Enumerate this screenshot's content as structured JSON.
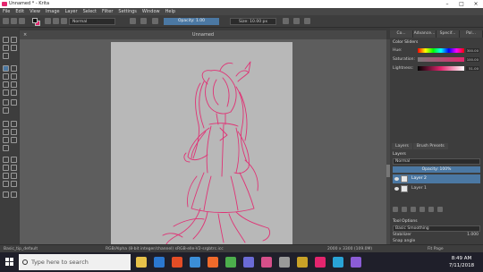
{
  "window": {
    "title": "Unnamed * - Krita",
    "controls": [
      "–",
      "□",
      "×"
    ]
  },
  "menu": [
    "File",
    "Edit",
    "View",
    "Image",
    "Layer",
    "Select",
    "Filter",
    "Settings",
    "Window",
    "Help"
  ],
  "toolbar": {
    "blend_mode": "Normal",
    "opacity": "Opacity: 1.00",
    "size": "Size: 10.00 px"
  },
  "canvas": {
    "tab_label": "Unnamed",
    "close": "×",
    "paper_color": "#b8b8b8",
    "stroke_color": "#e4256e"
  },
  "docker": {
    "tabs": [
      "Co...",
      "Advance...",
      "Specif...",
      "Pal..."
    ],
    "color_sliders_title": "Color Sliders",
    "sliders": [
      {
        "label": "Hue:",
        "value": "300.00"
      },
      {
        "label": "Saturation:",
        "value": "100.00"
      },
      {
        "label": "Lightness:",
        "value": "51.00"
      }
    ],
    "lower_tabs": [
      "Layers",
      "Brush Presets"
    ],
    "layers_title": "Layers",
    "layer_blend": "Normal",
    "layer_opacity": "Opacity: 100%",
    "layers": [
      {
        "name": "Layer 2",
        "selected": true
      },
      {
        "name": "Layer 1",
        "selected": false
      }
    ],
    "tool_options_title": "Tool Options",
    "smoothing": "Basic Smoothing",
    "stabilizer_label": "Stabilizer",
    "stabilizer_value": "1.000",
    "snap_label": "Snap angle"
  },
  "status": {
    "brush": "Basic_tip_default",
    "color_info": "RGB/Alpha (8-bit integer/channel)  sRGB-elle-V2-srgbtrc.icc",
    "dimensions": "2000 x 3300 (109.0M)",
    "fit": "Fit Page"
  },
  "taskbar": {
    "search_placeholder": "Type here to search",
    "time": "8:49 AM",
    "date": "7/11/2018",
    "app_colors": [
      "#e8c24a",
      "#2b78d0",
      "#e44d26",
      "#3b8ed8",
      "#ef6a2b",
      "#4cae4c",
      "#6b6bd6",
      "#d64f8a",
      "#999999",
      "#c9a227",
      "#e4256e",
      "#29a3d6",
      "#8b5cd6"
    ]
  }
}
